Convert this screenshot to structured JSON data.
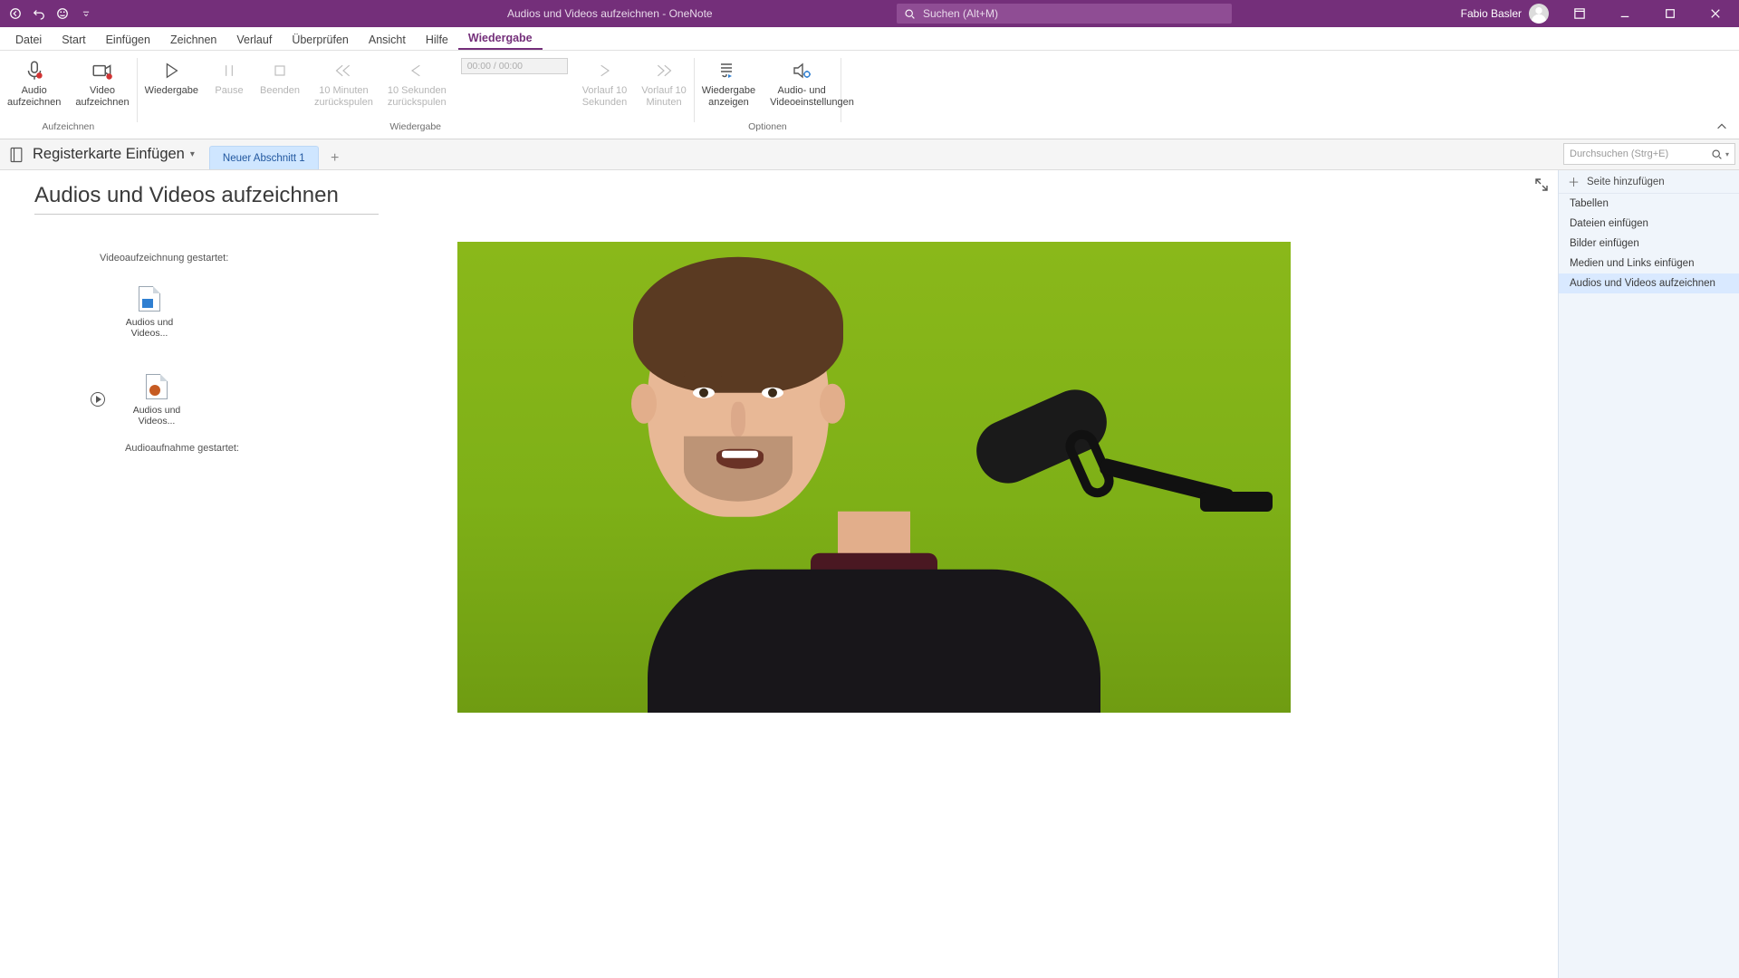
{
  "titlebar": {
    "doc_title": "Audios und Videos aufzeichnen",
    "app_sep": " - ",
    "app_name": "OneNote",
    "search_placeholder": "Suchen (Alt+M)",
    "user_name": "Fabio Basler"
  },
  "tabs": {
    "items": [
      "Datei",
      "Start",
      "Einfügen",
      "Zeichnen",
      "Verlauf",
      "Überprüfen",
      "Ansicht",
      "Hilfe",
      "Wiedergabe"
    ],
    "active_index": 8
  },
  "ribbon": {
    "group_record_label": "Aufzeichnen",
    "group_playback_label": "Wiedergabe",
    "group_options_label": "Optionen",
    "record_audio": "Audio\naufzeichnen",
    "record_video": "Video\naufzeichnen",
    "play": "Wiedergabe",
    "pause": "Pause",
    "stop": "Beenden",
    "back10m": "10 Minuten\nzurückspulen",
    "back10s": "10 Sekunden\nzurückspulen",
    "time_display": "00:00 / 00:00",
    "fwd10s": "Vorlauf 10\nSekunden",
    "fwd10m": "Vorlauf 10\nMinuten",
    "show_playback": "Wiedergabe\nanzeigen",
    "av_settings": "Audio- und\nVideoeinstellungen"
  },
  "notebook": {
    "name": "Registerkarte Einfügen",
    "section_tab": "Neuer Abschnitt 1",
    "search_placeholder": "Durchsuchen (Strg+E)"
  },
  "page": {
    "title": "Audios und Videos aufzeichnen",
    "video_started_label": "Videoaufzeichnung gestartet:",
    "audio_started_label": "Audioaufnahme gestartet:",
    "attachment1_name": "Audios und\nVideos...",
    "attachment2_name": "Audios und\nVideos..."
  },
  "page_pane": {
    "add_page": "Seite hinzufügen",
    "items": [
      "Tabellen",
      "Dateien einfügen",
      "Bilder einfügen",
      "Medien und Links einfügen",
      "Audios und Videos aufzeichnen"
    ],
    "selected_index": 4
  }
}
